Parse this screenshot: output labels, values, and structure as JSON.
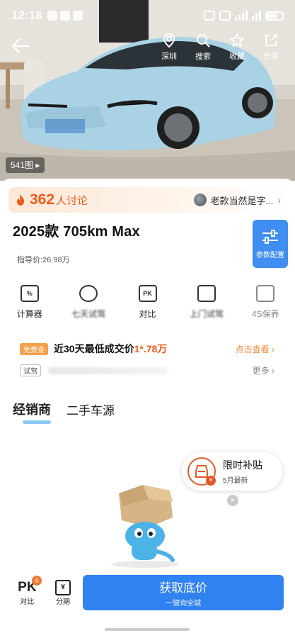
{
  "status_bar": {
    "time": "12:18",
    "battery": "49"
  },
  "hero": {
    "actions": [
      {
        "label": "深圳",
        "icon": "location-pin-icon"
      },
      {
        "label": "搜索",
        "icon": "search-icon"
      },
      {
        "label": "收藏",
        "icon": "star-icon"
      },
      {
        "label": "分享",
        "icon": "share-icon"
      }
    ],
    "photo_count": "541图 ▸"
  },
  "discussion": {
    "count": "362",
    "label": "人讨论",
    "comment": "老款当然是字..."
  },
  "model": {
    "title": "2025款 705km Max",
    "guide_price": "指导价:26.98万"
  },
  "param_button": {
    "label": "参数配置"
  },
  "tools": [
    {
      "label": "计算器",
      "icon": "calculator-icon",
      "glyph": "%",
      "blurred": false,
      "muted": false
    },
    {
      "label": "七天试驾",
      "icon": "steering-wheel-icon",
      "glyph": "",
      "blurred": true,
      "muted": false
    },
    {
      "label": "对比",
      "icon": "pk-icon",
      "glyph": "PK",
      "blurred": false,
      "muted": false
    },
    {
      "label": "上门试驾",
      "icon": "car-icon",
      "glyph": "",
      "blurred": true,
      "muted": false
    },
    {
      "label": "4S保养",
      "icon": "shop-icon",
      "glyph": "",
      "blurred": false,
      "muted": true
    }
  ],
  "deal": {
    "tag": "免费查",
    "text": "近30天最低成交价",
    "price": "1*.78万",
    "link": "点击查看 ›"
  },
  "test_drive": {
    "tag": "试驾",
    "more": "更多 ›"
  },
  "tabs": [
    {
      "label": "经销商",
      "active": true
    },
    {
      "label": "二手车源",
      "active": false
    }
  ],
  "subsidy": {
    "title": "限时补贴",
    "sub": "5月最新",
    "close": "×"
  },
  "bottom": {
    "pk_label": "PK",
    "pk_badge": "4",
    "compare": "对比",
    "installment_glyph": "¥",
    "installment": "分期",
    "cta_main": "获取底价",
    "cta_sub": "一键询全城"
  },
  "colors": {
    "brand_blue": "#2f82f0",
    "accent_orange": "#f05a1a",
    "car_body": "#a9d3e5"
  }
}
